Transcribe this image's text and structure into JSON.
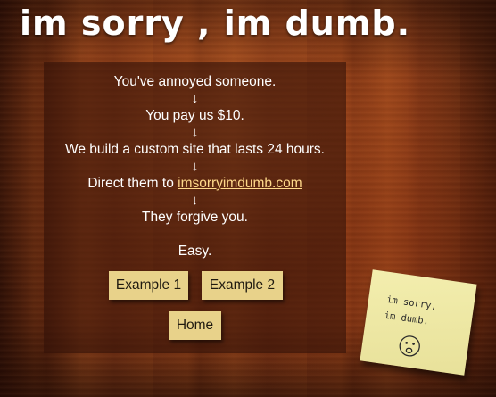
{
  "header": {
    "title": "im sorry , im dumb."
  },
  "steps": [
    "You've annoyed someone.",
    "You pay us $10.",
    "We build a custom site that lasts 24 hours.",
    "They forgive you."
  ],
  "arrow_glyph": "↓",
  "step4": {
    "prefix": "Direct them to ",
    "link_text": "imsorryimdumb.com"
  },
  "tagline": "Easy.",
  "buttons": {
    "example1": "Example 1",
    "example2": "Example 2",
    "home": "Home"
  },
  "sticky_note": {
    "line1": "im sorry,",
    "line2": "im dumb.",
    "face_icon": "sad-face-icon"
  },
  "colors": {
    "button_bg": "#e8d28a",
    "link": "#ffd98a",
    "sticky_note": "#f3eeae"
  }
}
